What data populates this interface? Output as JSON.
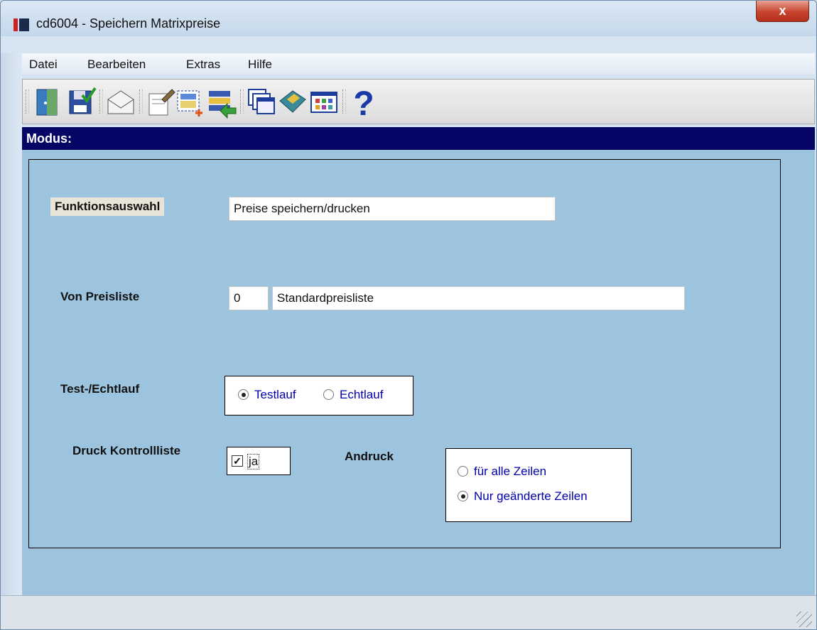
{
  "window": {
    "title": "cd6004 - Speichern Matrixpreise",
    "close_label": "x"
  },
  "menu": {
    "items": [
      "Datei",
      "Bearbeiten",
      "Extras",
      "Hilfe"
    ]
  },
  "toolbar": {
    "icons": [
      "exit-door-icon",
      "save-icon",
      "mail-icon",
      "edit-icon",
      "new-record-icon",
      "import-list-icon",
      "windows-icon",
      "book-icon",
      "grid-icon",
      "help-icon"
    ],
    "help_glyph": "?"
  },
  "mode_bar": {
    "label": "Modus:"
  },
  "form": {
    "funktionsauswahl": {
      "label": "Funktionsauswahl",
      "value": "Preise speichern/drucken"
    },
    "von_preisliste": {
      "label": "Von Preisliste",
      "number": "0",
      "name": "Standardpreisliste"
    },
    "lauf": {
      "label": "Test-/Echtlauf",
      "options": [
        "Testlauf",
        "Echtlauf"
      ],
      "selected": "Testlauf"
    },
    "druck_kontrollliste": {
      "label": "Druck Kontrollliste",
      "checked": true,
      "value": "ja"
    },
    "andruck": {
      "label": "Andruck",
      "options": [
        "für alle Zeilen",
        "Nur geänderte Zeilen"
      ],
      "selected": "Nur geänderte Zeilen"
    }
  },
  "colors": {
    "mode_bar": "#050566",
    "content_bg": "#9cc4df",
    "radio_text": "#0000aa"
  }
}
